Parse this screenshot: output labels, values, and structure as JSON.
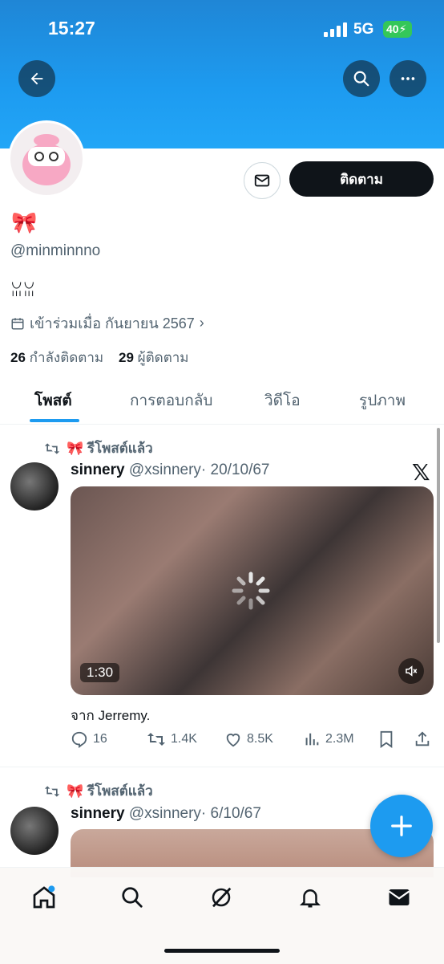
{
  "status_bar": {
    "time": "15:27",
    "network": "5G",
    "battery": "40"
  },
  "profile": {
    "name_emoji": "🎀",
    "handle": "@minminnno",
    "bio": "ꈍꈍ",
    "joined": "เข้าร่วมเมื่อ กันยายน 2567",
    "following_count": "26",
    "following_label": "กำลังติดตาม",
    "followers_count": "29",
    "followers_label": "ผู้ติดตาม",
    "follow_button": "ติดตาม"
  },
  "tabs": [
    {
      "label": "โพสต์",
      "active": true
    },
    {
      "label": "การตอบกลับ"
    },
    {
      "label": "วิดีโอ"
    },
    {
      "label": "รูปภาพ"
    }
  ],
  "posts": [
    {
      "repost_label": "🎀 รีโพสต์แล้ว",
      "author_name": "sinnery",
      "author_handle": "@xsinnery",
      "date": "· 20/10/67",
      "video_duration": "1:30",
      "caption": "จาก Jerremy.",
      "stats": {
        "replies": "16",
        "reposts": "1.4K",
        "likes": "8.5K",
        "views": "2.3M"
      }
    },
    {
      "repost_label": "🎀 รีโพสต์แล้ว",
      "author_name": "sinnery",
      "author_handle": "@xsinnery",
      "date": "· 6/10/67"
    }
  ],
  "colors": {
    "accent": "#1d9bf0",
    "text": "#0f1419",
    "muted": "#536471"
  }
}
